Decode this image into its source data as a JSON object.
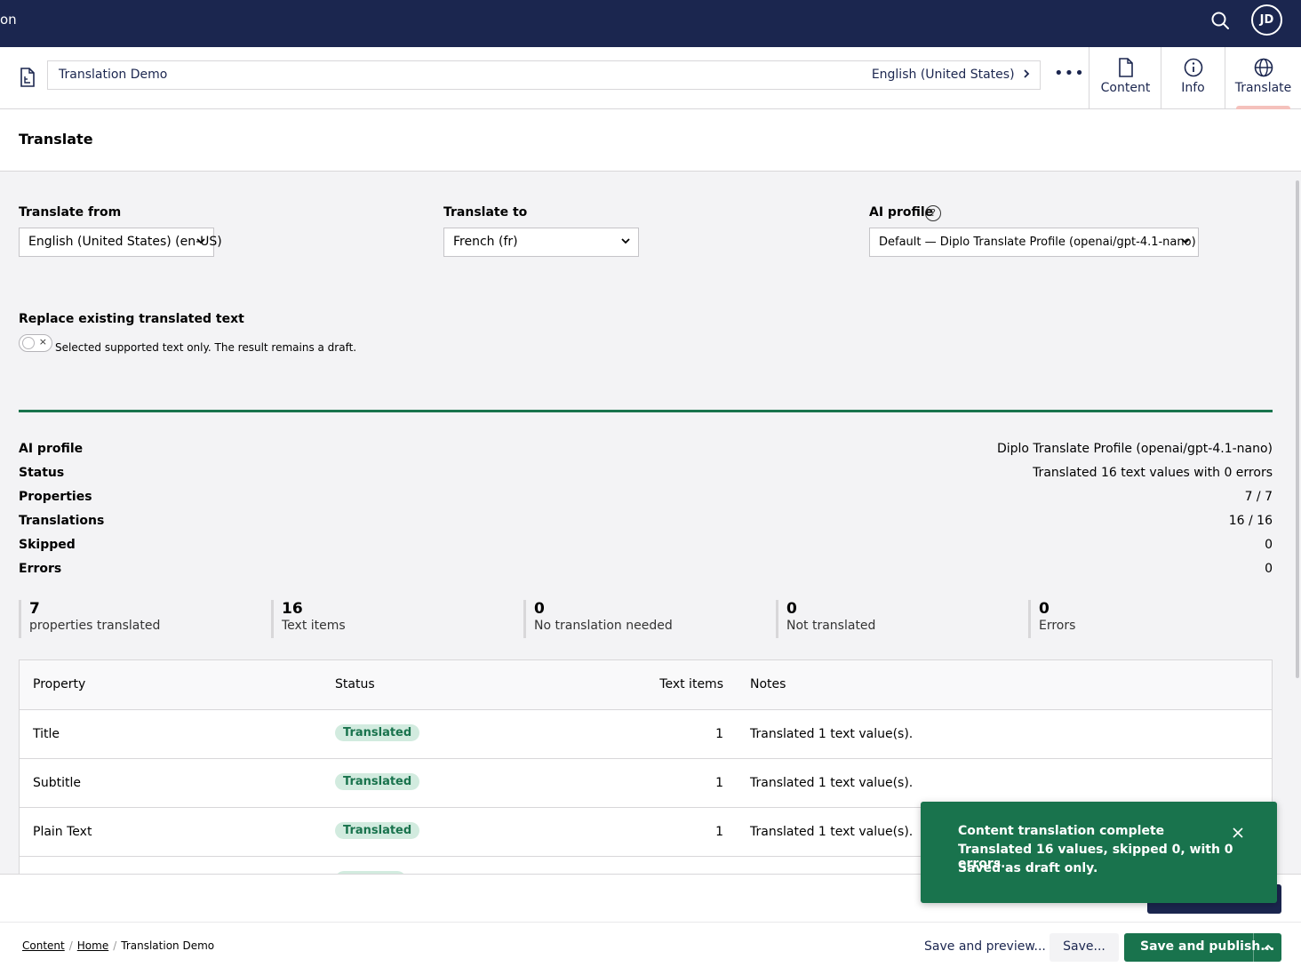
{
  "topbar": {
    "app_name": "on",
    "avatar_initials": "JD",
    "icons": [
      "search-icon"
    ]
  },
  "editor": {
    "document_name": "Translation Demo",
    "culture": "English (United States)",
    "more_label": "•••",
    "tabs": [
      {
        "label": "Content",
        "icon": "document-icon"
      },
      {
        "label": "Info",
        "icon": "info-icon"
      },
      {
        "label": "Translate",
        "icon": "globe-icon",
        "active": true
      }
    ]
  },
  "headline": "Translate",
  "form": {
    "translate_from": {
      "label": "Translate from",
      "value": "English (United States) (en-US)"
    },
    "translate_to": {
      "label": "Translate to",
      "value": "French (fr)"
    },
    "ai_profile": {
      "label": "AI profile",
      "help": "?",
      "value": "Default — Diplo Translate Profile (openai/gpt-4.1-nano)"
    },
    "replace": {
      "label": "Replace existing translated text",
      "toggle_on": false,
      "toggle_mark": "×",
      "description": "Selected supported text only. The result remains a draft."
    }
  },
  "progress": 1.0,
  "summary": [
    {
      "key": "AI profile",
      "value": "Diplo Translate Profile (openai/gpt-4.1-nano)"
    },
    {
      "key": "Status",
      "value": "Translated 16 text values with 0 errors"
    },
    {
      "key": "Properties",
      "value": "7 / 7"
    },
    {
      "key": "Translations",
      "value": "16 / 16"
    },
    {
      "key": "Skipped",
      "value": "0"
    },
    {
      "key": "Errors",
      "value": "0"
    }
  ],
  "stats": [
    {
      "number": "7",
      "label": "properties translated"
    },
    {
      "number": "16",
      "label": "Text items"
    },
    {
      "number": "0",
      "label": "No translation needed"
    },
    {
      "number": "0",
      "label": "Not translated"
    },
    {
      "number": "0",
      "label": "Errors"
    }
  ],
  "table": {
    "headers": {
      "property": "Property",
      "status": "Status",
      "text_items": "Text items",
      "notes": "Notes"
    },
    "rows": [
      {
        "property": "Title",
        "status": "Translated",
        "text_items": "1",
        "notes": "Translated 1 text value(s)."
      },
      {
        "property": "Subtitle",
        "status": "Translated",
        "text_items": "1",
        "notes": "Translated 1 text value(s)."
      },
      {
        "property": "Plain Text",
        "status": "Translated",
        "text_items": "1",
        "notes": "Translated 1 text value(s)."
      }
    ]
  },
  "toast": {
    "title": "Content translation complete",
    "line2": "Translated 16 values, skipped 0, with 0 errors.",
    "line3": "Saved as draft only."
  },
  "footer": {
    "breadcrumbs": [
      "Content",
      "Home",
      "Translation Demo"
    ],
    "save_preview": "Save and preview...",
    "save": "Save...",
    "save_publish": "Save and publish..."
  },
  "colors": {
    "header_bg": "#1b264f",
    "success": "#19734d",
    "badge_bg": "#d2ebdf",
    "tab_indicator": "#f5c1bc"
  }
}
